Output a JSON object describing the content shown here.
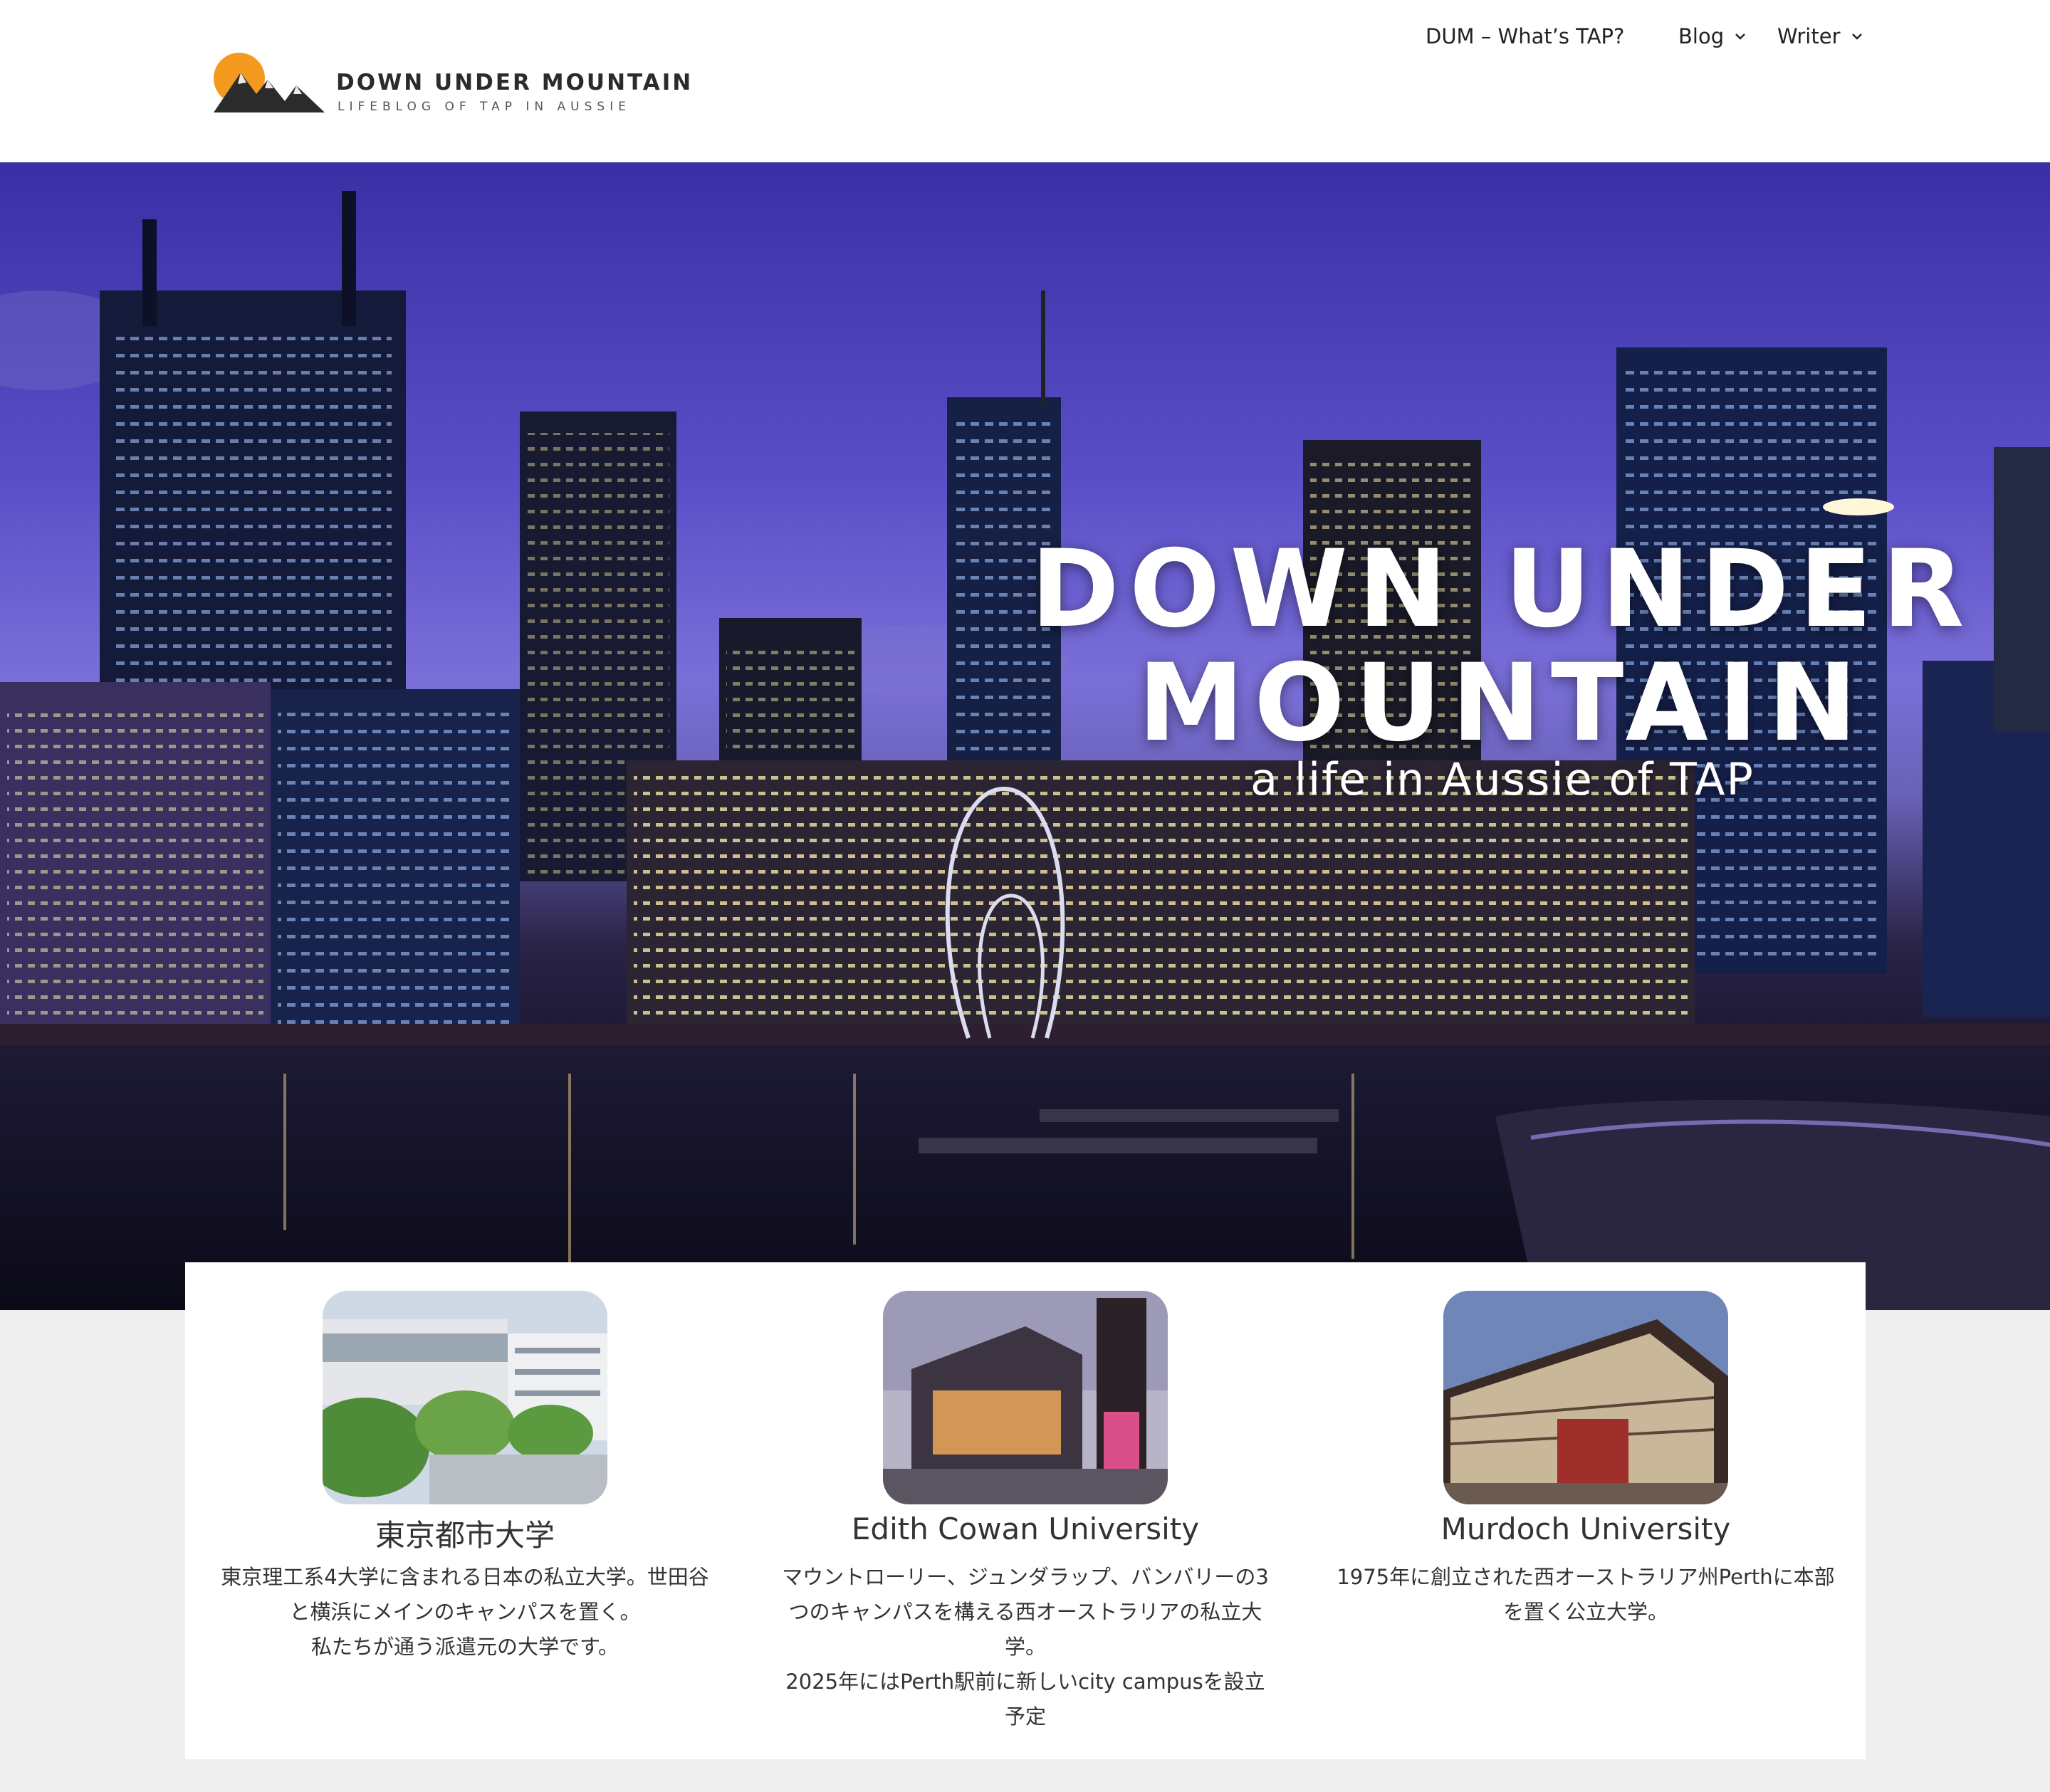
{
  "site": {
    "title": "DOWN UNDER MOUNTAIN",
    "tagline": "LIFEBLOG OF TAP IN AUSSIE"
  },
  "nav": {
    "items": [
      {
        "label": "DUM – What’s TAP?",
        "has_dropdown": false
      },
      {
        "label": "Blog",
        "has_dropdown": true
      },
      {
        "label": "Writer",
        "has_dropdown": true
      }
    ]
  },
  "hero": {
    "title_line1": "DOWN UNDER",
    "title_line2": "MOUNTAIN",
    "subtitle": "a life in Aussie of TAP"
  },
  "cards": [
    {
      "title": "東京都市大学",
      "text": [
        "東京理工系4大学に含まれる日本の私立大学。世田谷と横浜にメインのキャンパスを置く。",
        "私たちが通う派遣元の大学です。"
      ]
    },
    {
      "title": "Edith Cowan University",
      "text": [
        "マウントローリー、ジュンダラップ、バンバリーの3つのキャンパスを構える西オーストラリアの私立大学。",
        "2025年にはPerth駅前に新しいcity campusを設立予定"
      ]
    },
    {
      "title": "Murdoch University",
      "text": [
        "1975年に創立された西オーストラリア州Perthに本部を置く公立大学。"
      ]
    }
  ],
  "colors": {
    "logo_sun": "#f39a1e",
    "logo_mountain": "#2b2b2b",
    "header_bg": "#ffffff",
    "page_bg": "#efefef",
    "card_bg": "#ffffff"
  },
  "icons": [
    "logo-mountain-icon",
    "chevron-down-icon"
  ]
}
